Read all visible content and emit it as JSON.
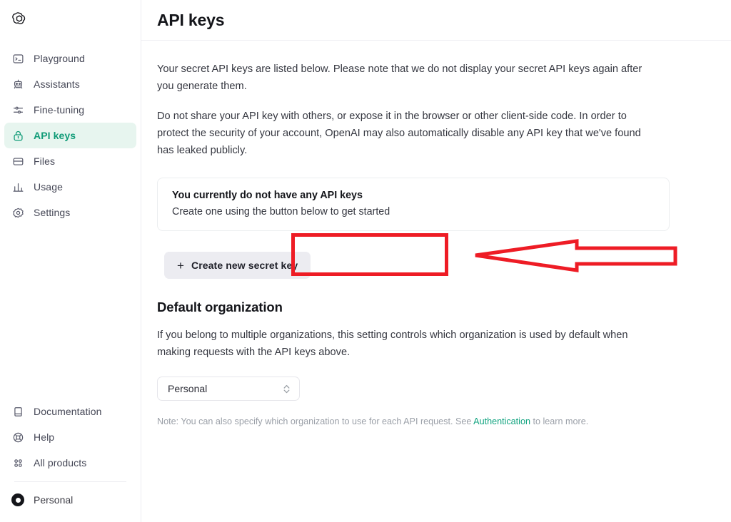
{
  "sidebar": {
    "logo_name": "openai-logo",
    "nav_items": [
      {
        "label": "Playground",
        "icon": "terminal-icon",
        "active": false
      },
      {
        "label": "Assistants",
        "icon": "robot-icon",
        "active": false
      },
      {
        "label": "Fine-tuning",
        "icon": "sliders-icon",
        "active": false
      },
      {
        "label": "API keys",
        "icon": "lock-icon",
        "active": true
      },
      {
        "label": "Files",
        "icon": "folder-icon",
        "active": false
      },
      {
        "label": "Usage",
        "icon": "bar-chart-icon",
        "active": false
      },
      {
        "label": "Settings",
        "icon": "gear-icon",
        "active": false
      }
    ],
    "bottom_items": [
      {
        "label": "Documentation",
        "icon": "book-icon"
      },
      {
        "label": "Help",
        "icon": "lifebuoy-icon"
      },
      {
        "label": "All products",
        "icon": "grid-icon"
      }
    ],
    "user": {
      "label": "Personal",
      "icon": "avatar-icon"
    }
  },
  "header": {
    "title": "API keys"
  },
  "main": {
    "paragraph_1": "Your secret API keys are listed below. Please note that we do not display your secret API keys again after you generate them.",
    "paragraph_2": "Do not share your API key with others, or expose it in the browser or other client-side code. In order to protect the security of your account, OpenAI may also automatically disable any API key that we've found has leaked publicly.",
    "callout": {
      "title": "You currently do not have any API keys",
      "subtitle": "Create one using the button below to get started"
    },
    "create_button": {
      "label": "Create new secret key",
      "plus": "+"
    },
    "default_org": {
      "heading": "Default organization",
      "description": "If you belong to multiple organizations, this setting controls which organization is used by default when making requests with the API keys above.",
      "select_value": "Personal",
      "select_options": [
        "Personal"
      ],
      "note_prefix": "Note: You can also specify which organization to use for each API request. See ",
      "note_link": "Authentication",
      "note_suffix": " to learn more."
    }
  },
  "annotations": {
    "highlight_color": "#ee1c25",
    "box_target": "create-new-secret-key-button",
    "arrow_direction": "left"
  },
  "colors": {
    "accent_green": "#10a37f",
    "active_nav_bg": "#e7f5ef",
    "annotation_red": "#ee1c25"
  }
}
